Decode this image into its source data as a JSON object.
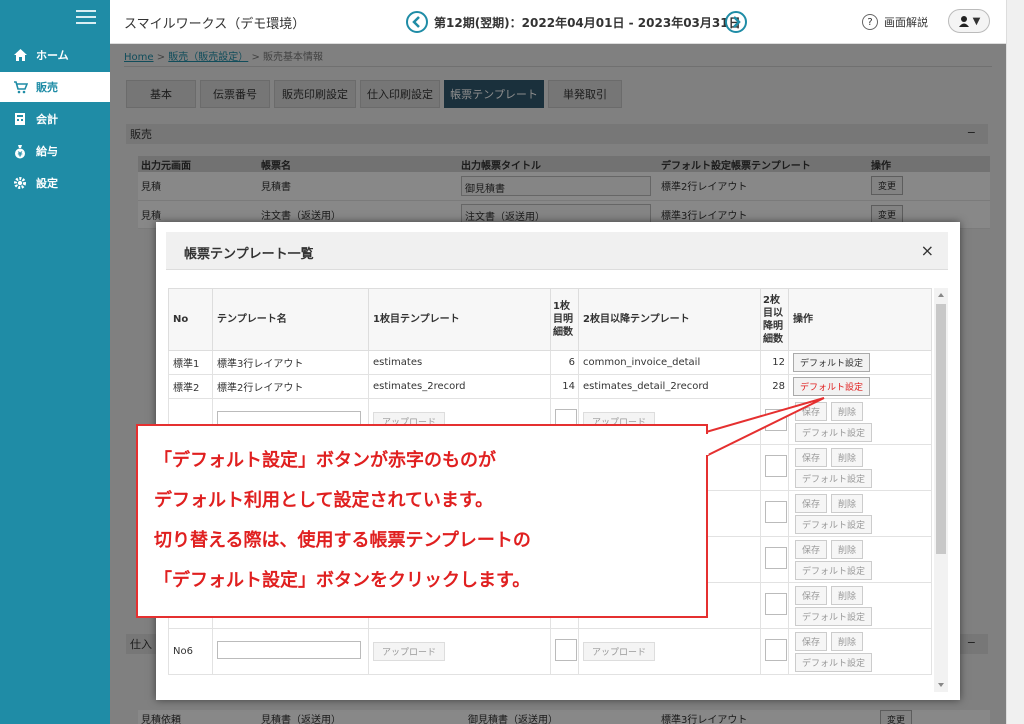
{
  "header": {
    "app_title": "スマイルワークス（デモ環境）",
    "period": "第12期(翌期)：2022年04月01日 - 2023年03月31日",
    "help_label": "画面解説",
    "user_caret": "▼"
  },
  "sidebar": {
    "items": [
      {
        "label": "ホーム",
        "icon": "home-icon"
      },
      {
        "label": "販売",
        "icon": "cart-icon"
      },
      {
        "label": "会計",
        "icon": "calculator-icon"
      },
      {
        "label": "給与",
        "icon": "money-bag-icon"
      },
      {
        "label": "設定",
        "icon": "gear-icon"
      }
    ]
  },
  "breadcrumb": {
    "home": "Home",
    "parent": "販売（販売設定）",
    "current": "販売基本情報"
  },
  "tabs": [
    "基本",
    "伝票番号",
    "販売印刷設定",
    "仕入印刷設定",
    "帳票テンプレート",
    "単発取引"
  ],
  "sections": {
    "sales": "販売",
    "purchase": "仕入",
    "minimize": "−"
  },
  "bg_table": {
    "headers": [
      "出力元画面",
      "帳票名",
      "出力帳票タイトル",
      "デフォルト設定帳票テンプレート",
      "操作"
    ],
    "rows": [
      {
        "screen": "見積",
        "name": "見積書",
        "title": "御見積書",
        "template": "標準2行レイアウト",
        "action": "変更"
      },
      {
        "screen": "見積",
        "name": "注文書（返送用）",
        "title": "注文書（返送用）",
        "template": "標準3行レイアウト",
        "action": "変更"
      }
    ],
    "bottom_row": {
      "screen": "見積依頼",
      "name": "見積書（返送用）",
      "title": "御見積書（返送用）",
      "template": "標準3行レイアウト",
      "action": "変更"
    }
  },
  "modal": {
    "title": "帳票テンプレート一覧",
    "close": "×",
    "headers": {
      "no": "No",
      "name": "テンプレート名",
      "tpl1": "1枚目テンプレート",
      "rows1": "1枚目明細数",
      "tpl2": "2枚目以降テンプレート",
      "rows2": "2枚目以降明細数",
      "ops": "操作"
    },
    "rows": [
      {
        "no": "標準1",
        "name": "標準3行レイアウト",
        "tpl1": "estimates",
        "rows1": "6",
        "tpl2": "common_invoice_detail",
        "rows2": "12",
        "default_label": "デフォルト設定",
        "is_default": false
      },
      {
        "no": "標準2",
        "name": "標準2行レイアウト",
        "tpl1": "estimates_2record",
        "rows1": "14",
        "tpl2": "estimates_detail_2record",
        "rows2": "28",
        "default_label": "デフォルト設定",
        "is_default": true
      }
    ],
    "custom_row_no": "No6",
    "upload_label": "アップロード",
    "save_label": "保存",
    "delete_label": "削除",
    "default_label": "デフォルト設定"
  },
  "callout": {
    "lines": [
      "「デフォルト設定」ボタンが赤字のものが",
      "デフォルト利用として設定されています。",
      "切り替える際は、使用する帳票テンプレートの",
      "「デフォルト設定」ボタンをクリックします。"
    ]
  },
  "colors": {
    "sidebar": "#1f8ca6",
    "active_tab": "#30586e",
    "callout": "#e53030"
  }
}
